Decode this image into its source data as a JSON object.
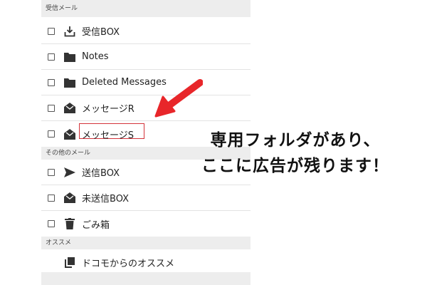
{
  "sections": {
    "received": "受信メール",
    "other": "その他のメール",
    "recommend": "オススメ"
  },
  "received_items": [
    {
      "label": "受信BOX",
      "icon": "inbox-download-icon"
    },
    {
      "label": "Notes",
      "icon": "folder-icon"
    },
    {
      "label": "Deleted Messages",
      "icon": "folder-icon"
    },
    {
      "label": "メッセージR",
      "icon": "open-envelope-icon"
    },
    {
      "label": "メッセージS",
      "icon": "open-envelope-icon"
    }
  ],
  "other_items": [
    {
      "label": "送信BOX",
      "icon": "send-icon"
    },
    {
      "label": "未送信BOX",
      "icon": "open-envelope-icon"
    },
    {
      "label": "ごみ箱",
      "icon": "trash-icon"
    }
  ],
  "recommend_items": [
    {
      "label": "ドコモからのオススメ",
      "icon": "copy-icon"
    }
  ],
  "annotation": {
    "line1": "専用フォルダがあり、",
    "line2": "ここに広告が残ります！"
  },
  "colors": {
    "arrow": "#e8262a",
    "highlight_border": "#d3333a",
    "section_bg": "#ededed"
  }
}
